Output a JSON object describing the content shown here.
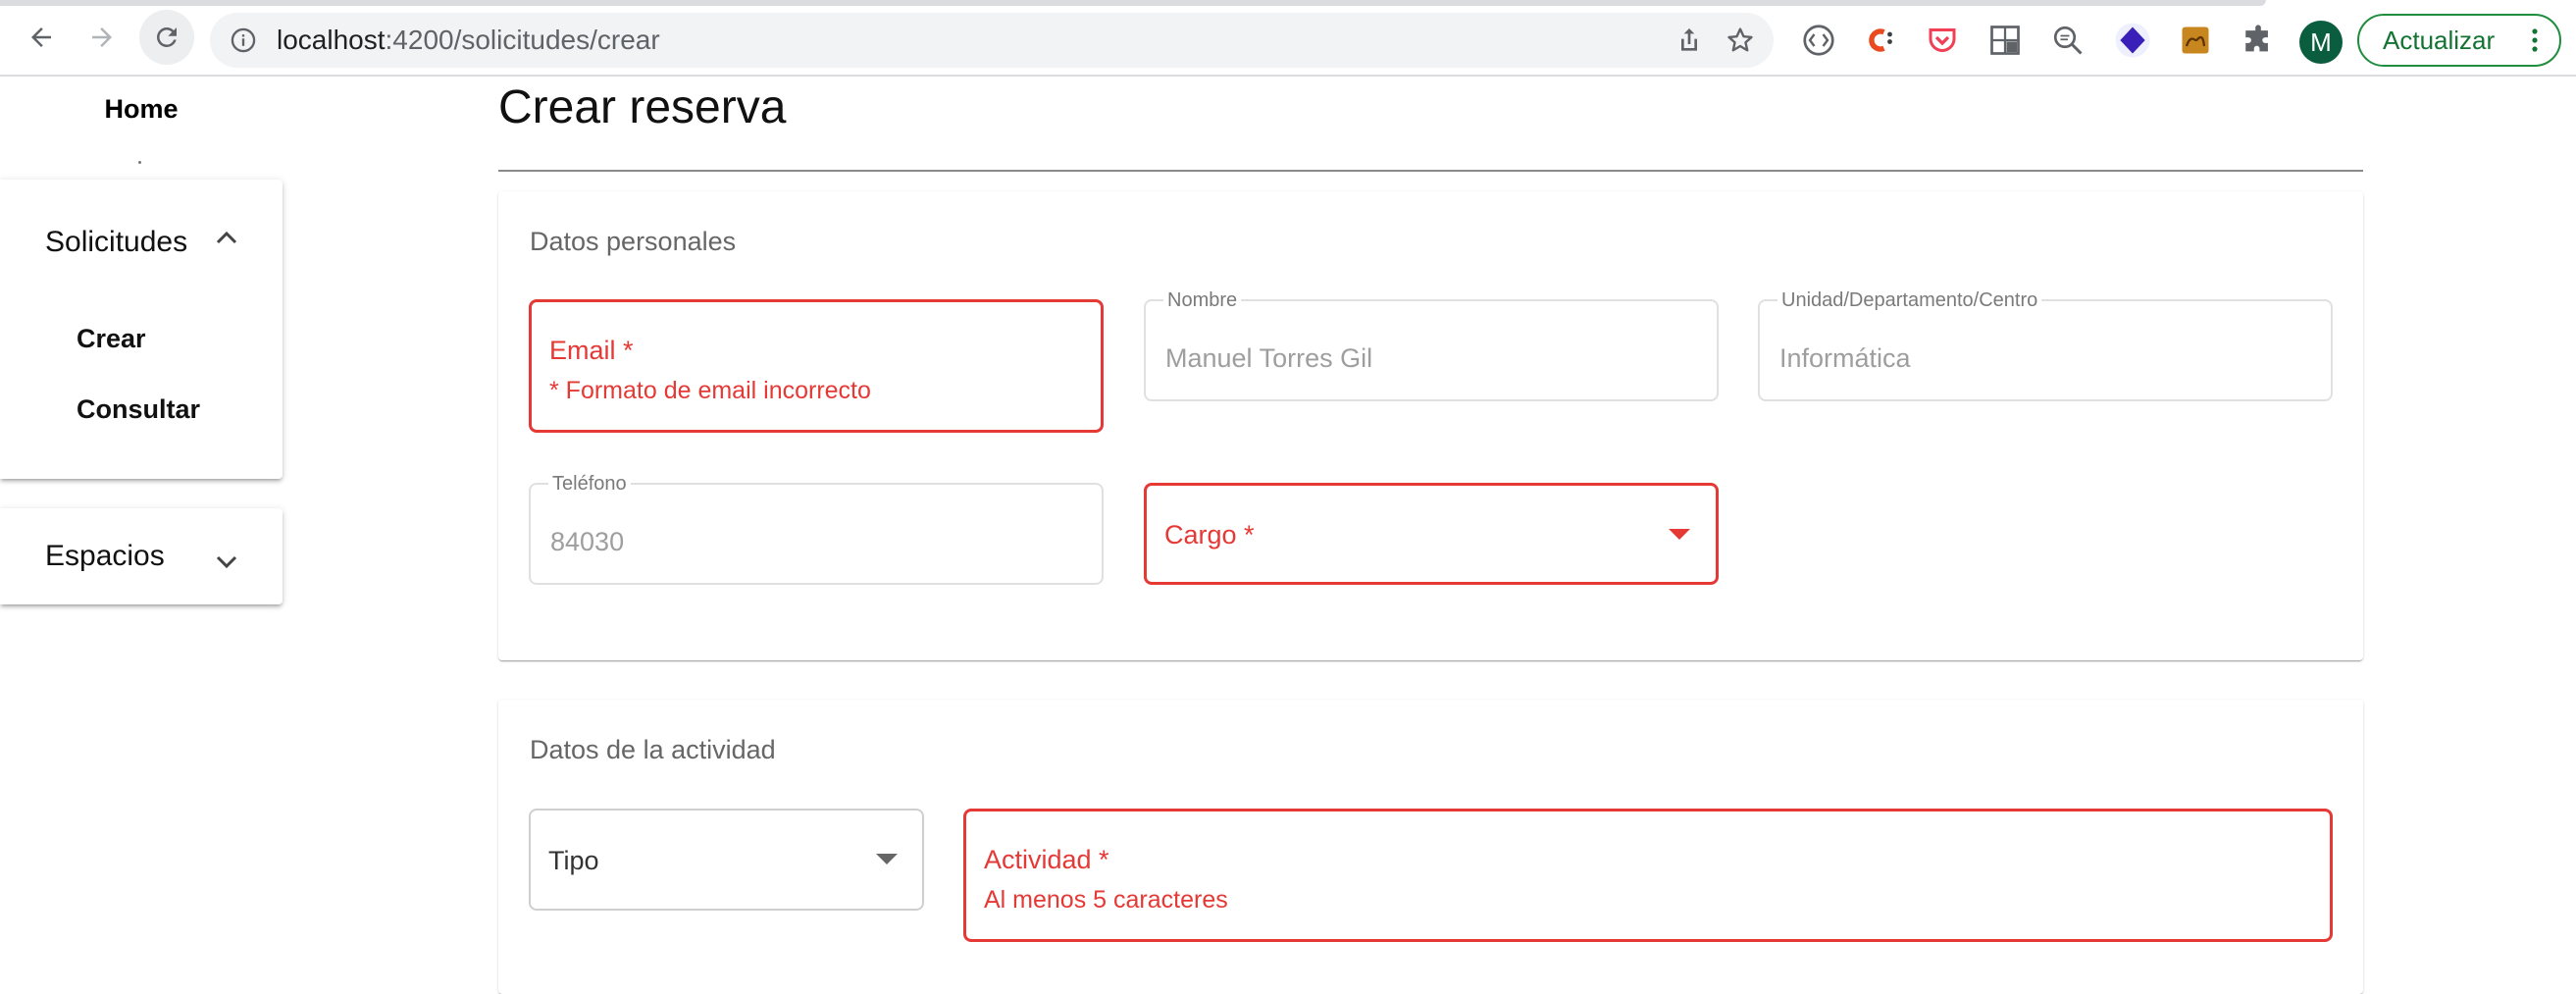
{
  "browser": {
    "url_host": "localhost",
    "url_path": ":4200/solicitudes/crear",
    "update_button": "Actualizar",
    "profile_initial": "M",
    "colors": {
      "update_green": "#137333",
      "avatar_bg": "#0b5d3f"
    },
    "extensions": [
      "code-brackets-icon",
      "c-extension-icon",
      "pocket-icon",
      "screen-grid-icon",
      "zoom-text-icon",
      "purple-diamond-icon",
      "camel-icon",
      "puzzle-icon"
    ]
  },
  "sidebar": {
    "home": "Home",
    "sections": [
      {
        "title": "Solicitudes",
        "expanded": true,
        "items": [
          "Crear",
          "Consultar"
        ]
      },
      {
        "title": "Espacios",
        "expanded": false,
        "items": []
      }
    ]
  },
  "main": {
    "title": "Crear reserva",
    "personal": {
      "heading": "Datos personales",
      "email_label": "Email *",
      "email_error": "* Formato de email incorrecto",
      "nombre_label": "Nombre",
      "nombre_value": "Manuel Torres Gil",
      "unidad_label": "Unidad/Departamento/Centro",
      "unidad_value": "Informática",
      "telefono_label": "Teléfono",
      "telefono_value": "84030",
      "cargo_label": "Cargo *"
    },
    "activity": {
      "heading": "Datos de la actividad",
      "tipo_label": "Tipo",
      "actividad_label": "Actividad *",
      "actividad_error": "Al menos 5 caracteres"
    },
    "colors": {
      "error": "#e53935"
    }
  }
}
